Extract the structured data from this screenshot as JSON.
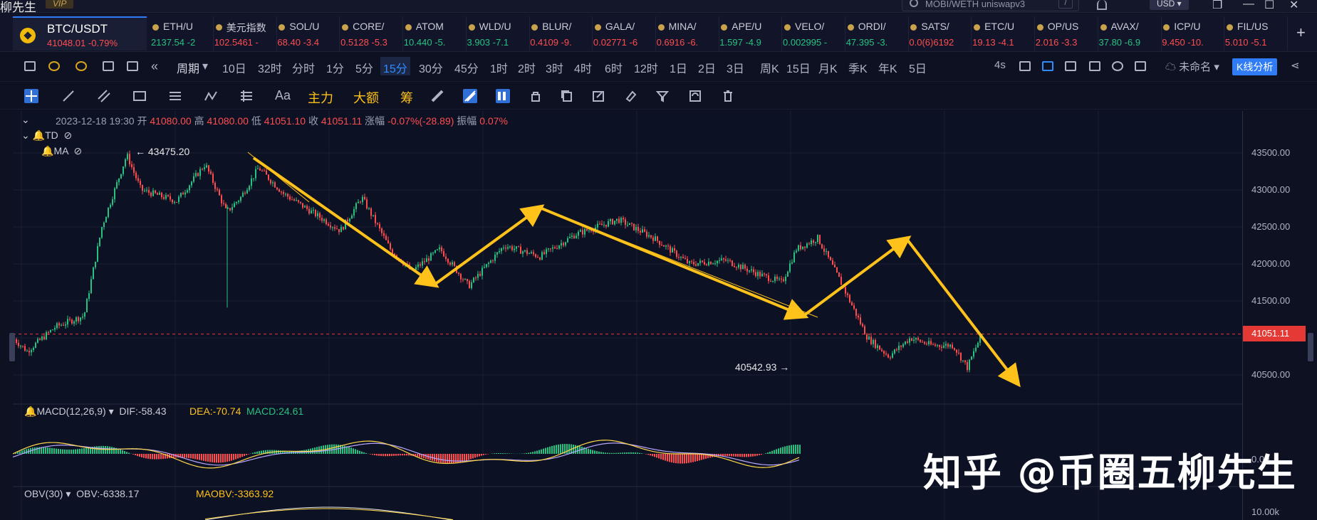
{
  "app": {
    "title": "柳先生",
    "vip": "VIP"
  },
  "search": {
    "text": "MOBI/WETH uniswapv3",
    "shortcut": "/"
  },
  "currency": "USD",
  "symbol": {
    "name": "BTC/USDT",
    "price": "41048.01",
    "change": "-0.79%"
  },
  "tickers": [
    {
      "name": "ETH/U",
      "price": "2137.54",
      "chg": "-2",
      "color": "#26c281"
    },
    {
      "name": "美元指数",
      "price": "102.5461",
      "chg": "-",
      "color": "#ff4d4f"
    },
    {
      "name": "SOL/U",
      "price": "68.40",
      "chg": "-3.4",
      "color": "#ff4d4f"
    },
    {
      "name": "CORE/",
      "price": "0.5128",
      "chg": "-5.3",
      "color": "#ff4d4f"
    },
    {
      "name": "ATOM",
      "price": "10.440",
      "chg": "-5.",
      "color": "#26c281"
    },
    {
      "name": "WLD/U",
      "price": "3.903",
      "chg": "-7.1",
      "color": "#26c281"
    },
    {
      "name": "BLUR/",
      "price": "0.4109",
      "chg": "-9.",
      "color": "#ff4d4f"
    },
    {
      "name": "GALA/",
      "price": "0.02771",
      "chg": "-6",
      "color": "#ff4d4f"
    },
    {
      "name": "MINA/",
      "price": "0.6916",
      "chg": "-6.",
      "color": "#ff4d4f"
    },
    {
      "name": "APE/U",
      "price": "1.597",
      "chg": "-4.9",
      "color": "#26c281"
    },
    {
      "name": "VELO/",
      "price": "0.002995",
      "chg": "-",
      "color": "#26c281"
    },
    {
      "name": "ORDI/",
      "price": "47.395",
      "chg": "-3.",
      "color": "#26c281"
    },
    {
      "name": "SATS/",
      "price": "0.0(6)6192",
      "chg": "",
      "color": "#ff4d4f"
    },
    {
      "name": "ETC/U",
      "price": "19.13",
      "chg": "-4.1",
      "color": "#ff4d4f"
    },
    {
      "name": "OP/US",
      "price": "2.016",
      "chg": "-3.3",
      "color": "#ff4d4f"
    },
    {
      "name": "AVAX/",
      "price": "37.80",
      "chg": "-6.9",
      "color": "#26c281"
    },
    {
      "name": "ICP/U",
      "price": "9.450",
      "chg": "-10.",
      "color": "#ff4d4f"
    },
    {
      "name": "FIL/US",
      "price": "5.010",
      "chg": "-5.1",
      "color": "#ff4d4f"
    }
  ],
  "periods": [
    "周期",
    "10日",
    "32时",
    "分时",
    "1分",
    "5分",
    "15分",
    "30分",
    "45分",
    "1时",
    "2时",
    "3时",
    "4时",
    "6时",
    "12时",
    "1日",
    "2日",
    "3日",
    "周K",
    "15日",
    "月K",
    "季K",
    "年K",
    "5日"
  ],
  "active_period": "15分",
  "toolbar_right": {
    "refresh": "4s",
    "layout_name": "未命名",
    "kline_btn": "K线分析"
  },
  "drawing_tools": {
    "text": "Aa",
    "main": "主力",
    "big": "大额",
    "chip": "筹"
  },
  "ohlc": {
    "date": "2023-12-18 19:30",
    "open_k": "开",
    "open": "41080.00",
    "high_k": "高",
    "high": "41080.00",
    "low_k": "低",
    "low": "41051.10",
    "close_k": "收",
    "close": "41051.11",
    "chg_k": "涨幅",
    "chg": "-0.07%(-28.89)",
    "amp_k": "振幅",
    "amp": "0.07%"
  },
  "indicators": {
    "td": "TD",
    "ma": "MA"
  },
  "annotations": {
    "high": "← 43475.20",
    "low": "40542.93 →"
  },
  "price_axis": [
    "43500.00",
    "43000.00",
    "42500.00",
    "42000.00",
    "41500.00",
    "40500.00"
  ],
  "current_price": "41051.11",
  "macd": {
    "name": "MACD(12,26,9)",
    "dif": "DIF:-58.43",
    "dea": "DEA:-70.74",
    "macd": "MACD:24.61",
    "axis": "0.00"
  },
  "obv": {
    "name": "OBV(30)",
    "obv": "OBV:-6338.17",
    "maobv": "MAOBV:-3363.92",
    "axis": "10.00k"
  },
  "watermark": "知乎 @币圈五柳先生",
  "colors": {
    "up": "#26c281",
    "down": "#ff4d4f",
    "arrow": "#ffc21a",
    "accent": "#2f7cf6"
  }
}
